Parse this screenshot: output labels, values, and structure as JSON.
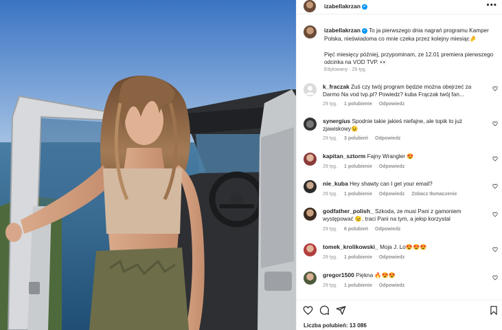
{
  "post": {
    "author": "izabellakrzan",
    "caption": {
      "author": "izabellakrzan",
      "paragraph1": "To ja pierwszego dnia nagrań programu Kamper Polska, nieświadoma co mnie czeka przez kolejny miesiąc🤌",
      "paragraph2": "Pięć miesięcy później, przypominam, ze 12.01 premiera pierwszego odcinka na VOD TVP. 👀",
      "edited_label": "Edytowany · 29 tyg."
    },
    "likes_label": "Liczba polubień: 13 086"
  },
  "labels": {
    "reply": "Odpowiedz",
    "see_translation": "Zobacz tłumaczenie"
  },
  "comments": [
    {
      "user": "k_fraczak",
      "text": "Zuś czy twój program będzie można obejrzeć za Darmo Na vod tvp.pl? Powiedz? kuba Frączak twój fan...",
      "age": "29 tyg.",
      "likes": "1 polubienie",
      "action": "Odpowiedz"
    },
    {
      "user": "synergius",
      "text": "Spodnie takie jakieś niefajne, ale topik to już zjawiskowy😉",
      "age": "29 tyg.",
      "likes": "3 polubień",
      "action": "Odpowiedz"
    },
    {
      "user": "kapitan_sztorm",
      "text": "Fajny Wrangler 😍",
      "age": "29 tyg.",
      "likes": "1 polubienie",
      "action": "Odpowiedz"
    },
    {
      "user": "nie_kuba",
      "text": "Hey shawty can I get your email?",
      "age": "29 tyg.",
      "likes": "1 polubienie",
      "action": "Odpowiedz",
      "extra": "Zobacz tłumaczenie"
    },
    {
      "user": "godfather_polish_",
      "text": "Szkoda, ze musi Pani z gamoniem występować 😉, traci Pani na tym, a jełop korzystal",
      "age": "29 tyg.",
      "likes": "6 polubień",
      "action": "Odpowiedz"
    },
    {
      "user": "tomek_krolikowski_",
      "text": "Moja J. Lo😍😍😍",
      "age": "29 tyg.",
      "likes": "1 polubienie",
      "action": "Odpowiedz"
    },
    {
      "user": "gregor1500",
      "text": "Piękna 🔥😍😍",
      "age": "29 tyg.",
      "likes": "1 polubienie",
      "action": "Odpowiedz"
    }
  ],
  "icons": {
    "like": "heart-icon",
    "comment": "comment-icon",
    "share": "share-icon",
    "save": "bookmark-icon",
    "more": "more-icon",
    "verified": "verified-badge-icon"
  },
  "colors": {
    "verified": "#0095f6",
    "muted": "#8e8e8e",
    "text": "#262626"
  }
}
